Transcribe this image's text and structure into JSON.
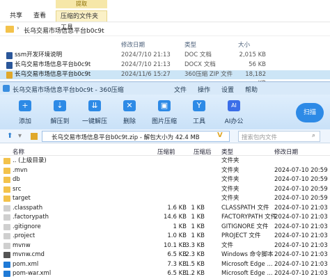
{
  "explorer": {
    "ribbon": {
      "extract_label": "提取",
      "tabs": [
        "共享",
        "查看",
        "压缩的文件夹工具"
      ]
    },
    "address": "长乌交易市场信息平台b0c9t",
    "headers": {
      "date": "修改日期",
      "type": "类型",
      "size": "大小"
    },
    "files": [
      {
        "name": "ssm开发环境说明",
        "date": "2024/7/10 21:13",
        "type": "DOC 文档",
        "size": "2,015 KB",
        "icon_color": "#2b579a"
      },
      {
        "name": "长乌交易市场信息平台b0c9t",
        "date": "2024/7/10 21:13",
        "type": "DOCX 文档",
        "size": "56 KB",
        "icon_color": "#2b579a"
      },
      {
        "name": "长乌交易市场信息平台b0c9t",
        "date": "2024/11/6 15:27",
        "type": "360压缩 ZIP 文件",
        "size": "18,182 KB",
        "icon_color": "#e0a82a"
      }
    ]
  },
  "zip_window": {
    "title": "长乌交易市场信息平台b0c9t - 360压缩",
    "menu": [
      "文件",
      "操作",
      "设置",
      "帮助"
    ],
    "toolbar": [
      {
        "label": "添加",
        "icon": "add-icon",
        "glyph": "+"
      },
      {
        "label": "解压到",
        "icon": "extract-to-icon",
        "glyph": "⇣"
      },
      {
        "label": "一键解压",
        "icon": "one-click-extract-icon",
        "glyph": "⇊"
      },
      {
        "label": "删除",
        "icon": "delete-icon",
        "glyph": "✕"
      },
      {
        "label": "图片压缩",
        "icon": "image-compress-icon",
        "glyph": "▣"
      },
      {
        "label": "工具",
        "icon": "tools-icon",
        "glyph": "Y"
      },
      {
        "label": "AI办公",
        "icon": "ai-office-icon",
        "glyph": "AI"
      }
    ],
    "scan_label": "扫描",
    "path_text": "长乌交易市场信息平台b0c9t.zip - 解包大小为 42.4 MB",
    "search_placeholder": "搜索包内文件",
    "columns": {
      "name": "名称",
      "compressed": "压缩前",
      "original": "压缩后",
      "type": "类型",
      "modified": "修改日期"
    },
    "rows": [
      {
        "name": ".. (上级目录)",
        "compressed": "",
        "original": "",
        "type": "文件夹",
        "modified": "",
        "icon_color": "#f3c24b"
      },
      {
        "name": ".mvn",
        "compressed": "",
        "original": "",
        "type": "文件夹",
        "modified": "2024-07-10 20:59",
        "icon_color": "#f3c24b"
      },
      {
        "name": "db",
        "compressed": "",
        "original": "",
        "type": "文件夹",
        "modified": "2024-07-10 20:59",
        "icon_color": "#f3c24b"
      },
      {
        "name": "src",
        "compressed": "",
        "original": "",
        "type": "文件夹",
        "modified": "2024-07-10 20:59",
        "icon_color": "#f3c24b"
      },
      {
        "name": "target",
        "compressed": "",
        "original": "",
        "type": "文件夹",
        "modified": "2024-07-10 20:59",
        "icon_color": "#f3c24b"
      },
      {
        "name": ".classpath",
        "compressed": "1.6 KB",
        "original": "1 KB",
        "type": "CLASSPATH 文件",
        "modified": "2024-07-10 21:03",
        "icon_color": "#cfcfcf"
      },
      {
        "name": ".factorypath",
        "compressed": "14.6 KB",
        "original": "1 KB",
        "type": "FACTORYPATH 文件",
        "modified": "2024-07-10 21:03",
        "icon_color": "#cfcfcf"
      },
      {
        "name": ".gitignore",
        "compressed": "1 KB",
        "original": "1 KB",
        "type": "GITIGNORE 文件",
        "modified": "2024-07-10 21:03",
        "icon_color": "#cfcfcf"
      },
      {
        "name": ".project",
        "compressed": "1.0 KB",
        "original": "1 KB",
        "type": "PROJECT 文件",
        "modified": "2024-07-10 21:03",
        "icon_color": "#cfcfcf"
      },
      {
        "name": "mvnw",
        "compressed": "10.1 KB",
        "original": "3.3 KB",
        "type": "文件",
        "modified": "2024-07-10 21:03",
        "icon_color": "#cfcfcf"
      },
      {
        "name": "mvnw.cmd",
        "compressed": "6.5 KB",
        "original": "2.3 KB",
        "type": "Windows 命令脚本",
        "modified": "2024-07-10 21:03",
        "icon_color": "#555555"
      },
      {
        "name": "pom.xml",
        "compressed": "7.3 KB",
        "original": "1.5 KB",
        "type": "Microsoft Edge ...",
        "modified": "2024-07-10 21:03",
        "icon_color": "#1f7ad6"
      },
      {
        "name": "pom-war.xml",
        "compressed": "6.5 KB",
        "original": "1.2 KB",
        "type": "Microsoft Edge ...",
        "modified": "2024-07-10 21:03",
        "icon_color": "#1f7ad6"
      }
    ]
  }
}
